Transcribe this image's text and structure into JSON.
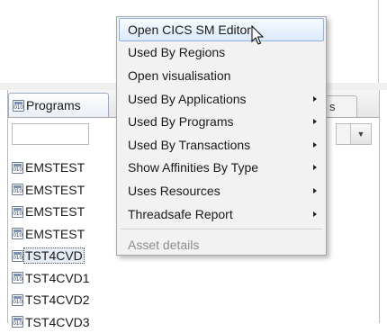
{
  "programs_view": {
    "tab_label": "Programs",
    "other_tab_label": "s",
    "filter_value": "",
    "combo_arrow": "▼",
    "items": [
      {
        "label": "EMSTEST",
        "selected": false
      },
      {
        "label": "EMSTEST",
        "selected": false
      },
      {
        "label": "EMSTEST",
        "selected": false
      },
      {
        "label": "EMSTEST",
        "selected": false
      },
      {
        "label": "TST4CVD",
        "selected": true
      },
      {
        "label": "TST4CVD1",
        "selected": false
      },
      {
        "label": "TST4CVD2",
        "selected": false
      },
      {
        "label": "TST4CVD3",
        "selected": false
      }
    ]
  },
  "context_menu": {
    "items": [
      {
        "label": "Open CICS SM Editor",
        "submenu": false,
        "highlighted": true,
        "disabled": false
      },
      {
        "label": "Used By Regions",
        "submenu": false,
        "highlighted": false,
        "disabled": false
      },
      {
        "label": "Open visualisation",
        "submenu": false,
        "highlighted": false,
        "disabled": false
      },
      {
        "label": "Used By Applications",
        "submenu": true,
        "highlighted": false,
        "disabled": false
      },
      {
        "label": "Used By Programs",
        "submenu": true,
        "highlighted": false,
        "disabled": false
      },
      {
        "label": "Used By Transactions",
        "submenu": true,
        "highlighted": false,
        "disabled": false
      },
      {
        "label": "Show Affinities By Type",
        "submenu": true,
        "highlighted": false,
        "disabled": false
      },
      {
        "label": "Uses Resources",
        "submenu": true,
        "highlighted": false,
        "disabled": false
      },
      {
        "label": "Threadsafe Report",
        "submenu": true,
        "highlighted": false,
        "disabled": false
      },
      {
        "label": "Asset details",
        "submenu": false,
        "highlighted": false,
        "disabled": true
      }
    ]
  },
  "icons": {
    "program_icon": "program-binary-icon",
    "cursor": "mouse-pointer-icon"
  },
  "colors": {
    "menu_highlight_border": "#8fb2e3",
    "menu_background": "#f2f2f2",
    "disabled_text": "#8e8e8e"
  }
}
